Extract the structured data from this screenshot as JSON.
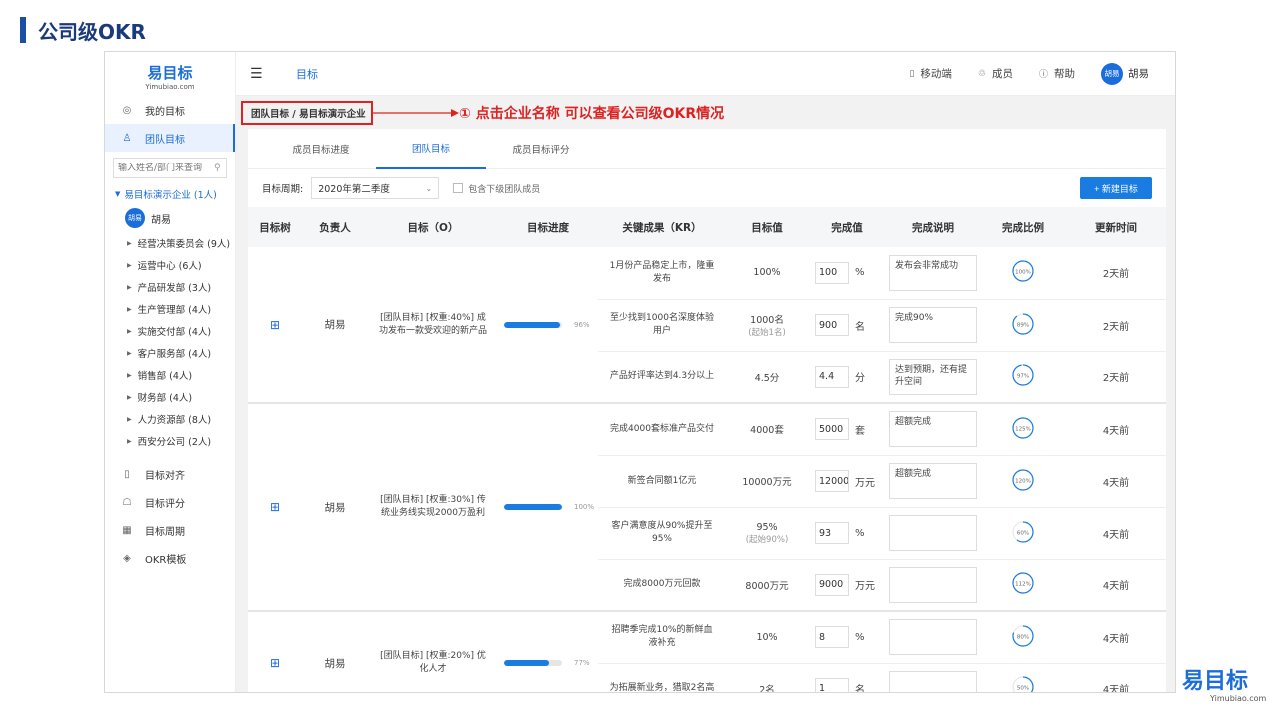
{
  "slide": {
    "title": "公司级OKR"
  },
  "logo": {
    "main": "易目标",
    "sub": "Yimubiao.com"
  },
  "brand": {
    "main": "易目标",
    "sub": "Yimubiao.com"
  },
  "sidebar": {
    "items": [
      {
        "label": "我的目标",
        "icon": "target-icon"
      },
      {
        "label": "团队目标",
        "icon": "team-icon"
      }
    ],
    "search_placeholder": "输入姓名/部门来查询",
    "tree_root": "易目标演示企业 (1人)",
    "tree_user": {
      "avatar": "胡易",
      "name": "胡易"
    },
    "departments": [
      "经营决策委员会 (9人)",
      "运营中心 (6人)",
      "产品研发部 (3人)",
      "生产管理部 (4人)",
      "实施交付部 (4人)",
      "客户服务部 (4人)",
      "销售部 (4人)",
      "财务部 (4人)",
      "人力资源部 (8人)",
      "西安分公司 (2人)"
    ],
    "bottom_items": [
      {
        "label": "目标对齐",
        "icon": "align-icon"
      },
      {
        "label": "目标评分",
        "icon": "score-icon"
      },
      {
        "label": "目标周期",
        "icon": "calendar-icon"
      },
      {
        "label": "OKR模板",
        "icon": "layers-icon"
      }
    ]
  },
  "header": {
    "title": "目标",
    "links": [
      {
        "label": "移动端",
        "icon": "mobile-icon"
      },
      {
        "label": "成员",
        "icon": "members-icon"
      },
      {
        "label": "帮助",
        "icon": "help-icon"
      }
    ],
    "avatar": "胡易",
    "user_name": "胡易"
  },
  "breadcrumb": "团队目标 / 易目标演示企业",
  "annotation": "① 点击企业名称  可以查看公司级OKR情况",
  "tabs": [
    "成员目标进度",
    "团队目标",
    "成员目标评分"
  ],
  "filter": {
    "label": "目标周期:",
    "period": "2020年第二季度",
    "checkbox_label": "包含下级团队成员",
    "new_button": "+  新建目标"
  },
  "table": {
    "headers": [
      "目标树",
      "负责人",
      "目标（O）",
      "目标进度",
      "关键成果（KR）",
      "目标值",
      "完成值",
      "完成说明",
      "完成比例",
      "更新时间"
    ],
    "objectives": [
      {
        "owner": "胡易",
        "title": "[团队目标] [权重:40%] 成功发布一款受欢迎的新产品",
        "progress": 96,
        "progress_label": "96%",
        "krs": [
          {
            "kr": "1月份产品稳定上市，隆重发布",
            "target": "100%",
            "target_sub": "",
            "value": "100",
            "unit": "%",
            "desc": "发布会非常成功",
            "ratio": 100,
            "ratio_label": "100%",
            "time": "2天前"
          },
          {
            "kr": "至少找到1000名深度体验用户",
            "target": "1000名",
            "target_sub": "(起始1名)",
            "value": "900",
            "unit": "名",
            "desc": "完成90%",
            "ratio": 89,
            "ratio_label": "89%",
            "time": "2天前"
          },
          {
            "kr": "产品好评率达到4.3分以上",
            "target": "4.5分",
            "target_sub": "",
            "value": "4.4",
            "unit": "分",
            "desc": "达到预期，还有提升空间",
            "ratio": 97,
            "ratio_label": "97%",
            "time": "2天前"
          }
        ]
      },
      {
        "owner": "胡易",
        "title": "[团队目标] [权重:30%] 传统业务线实现2000万盈利",
        "progress": 100,
        "progress_label": "100%",
        "krs": [
          {
            "kr": "完成4000套标准产品交付",
            "target": "4000套",
            "target_sub": "",
            "value": "5000",
            "unit": "套",
            "desc": "超额完成",
            "ratio": 100,
            "ratio_label": "125%",
            "time": "4天前"
          },
          {
            "kr": "新签合同额1亿元",
            "target": "10000万元",
            "target_sub": "",
            "value": "12000",
            "unit": "万元",
            "desc": "超额完成",
            "ratio": 100,
            "ratio_label": "120%",
            "time": "4天前"
          },
          {
            "kr": "客户满意度从90%提升至95%",
            "target": "95%",
            "target_sub": "(起始90%)",
            "value": "93",
            "unit": "%",
            "desc": "",
            "ratio": 60,
            "ratio_label": "60%",
            "time": "4天前"
          },
          {
            "kr": "完成8000万元回款",
            "target": "8000万元",
            "target_sub": "",
            "value": "9000",
            "unit": "万元",
            "desc": "",
            "ratio": 100,
            "ratio_label": "112%",
            "time": "4天前"
          }
        ]
      },
      {
        "owner": "胡易",
        "title": "[团队目标] [权重:20%] 优化人才",
        "progress": 77,
        "progress_label": "77%",
        "krs": [
          {
            "kr": "招聘季完成10%的新鲜血液补充",
            "target": "10%",
            "target_sub": "",
            "value": "8",
            "unit": "%",
            "desc": "",
            "ratio": 80,
            "ratio_label": "80%",
            "time": "4天前"
          },
          {
            "kr": "为拓展新业务，猎取2名高",
            "target": "2名",
            "target_sub": "",
            "value": "1",
            "unit": "名",
            "desc": "",
            "ratio": 50,
            "ratio_label": "50%",
            "time": "4天前"
          }
        ]
      }
    ]
  },
  "colors": {
    "accent": "#1a7be0",
    "annotation": "#dd2222",
    "title": "#1a3a7a"
  }
}
